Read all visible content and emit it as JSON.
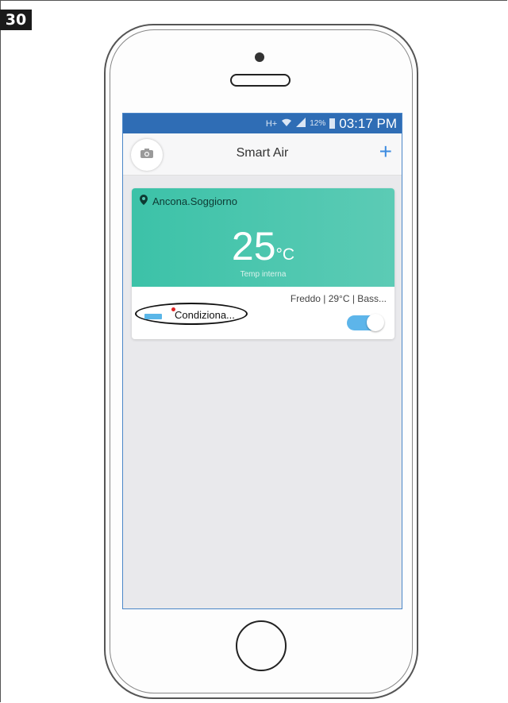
{
  "page_number": "30",
  "status_bar": {
    "network": "H+",
    "battery": "12%",
    "time": "03:17 PM"
  },
  "header": {
    "title": "Smart Air",
    "left_icon": "camera-icon",
    "right_icon": "plus-icon"
  },
  "room_card": {
    "location": "Ancona.Soggiorno",
    "temperature": "25",
    "unit": "°C",
    "temp_label": "Temp interna",
    "mode_summary": "Freddo | 29°C | Bass...",
    "device_name": "Condiziona...",
    "power_on": true
  },
  "colors": {
    "status_bar": "#2f6db5",
    "card_gradient_start": "#3cc2a8",
    "accent_blue": "#3d8be0",
    "toggle_on": "#5db5ea",
    "alert_dot": "#e02424"
  }
}
